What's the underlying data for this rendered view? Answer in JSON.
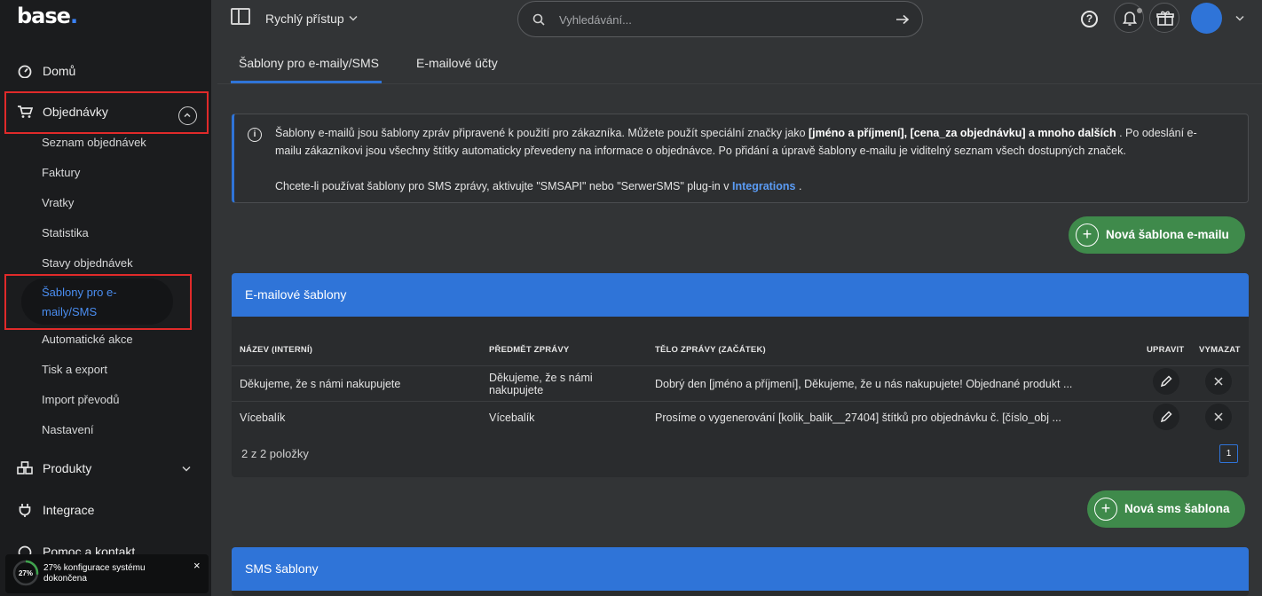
{
  "brand": {
    "logo_text": "base",
    "logo_dot": ".",
    "accent_color": "#2f74d8",
    "logo_dot_color": "#3b82f6"
  },
  "sidebar": {
    "items": [
      {
        "label": "Domů",
        "icon": "dashboard-icon"
      },
      {
        "label": "Objednávky",
        "icon": "cart-icon",
        "expanded": true
      },
      {
        "label": "Produkty",
        "icon": "boxes-icon"
      },
      {
        "label": "Integrace",
        "icon": "plug-icon"
      },
      {
        "label": "Pomoc a kontakt",
        "icon": "help-icon"
      }
    ],
    "orders_sub": [
      "Seznam objednávek",
      "Faktury",
      "Vratky",
      "Statistika",
      "Stavy objednávek",
      "Šablony pro e-maily/SMS",
      "Automatické akce",
      "Tisk a export",
      "Import převodů",
      "Nastavení"
    ],
    "progress": {
      "percent_label": "27%",
      "percent_value": 27,
      "text": "27% konfigurace systému dokončena",
      "close": "×"
    }
  },
  "topbar": {
    "quick_access": "Rychlý přístup",
    "search_placeholder": "Vyhledávání...",
    "help_symbol": "?"
  },
  "tabs": [
    {
      "label": "Šablony pro e-maily/SMS",
      "active": true
    },
    {
      "label": "E-mailové účty",
      "active": false
    }
  ],
  "info": {
    "icon_symbol": "i",
    "p1_a": "Šablony e-mailů jsou šablony zpráv připravené k použití pro zákazníka. Můžete použít speciální značky jako ",
    "p1_b1": "[jméno a příjmení]",
    "p1_c": ", ",
    "p1_b2": "[cena_za objednávku]",
    "p1_b3": " a mnoho dalších",
    "p1_d": " . Po odeslání e-mailu zákazníkovi jsou všechny štítky automaticky převedeny na informace o objednávce. Po přidání a úpravě šablony e-mailu je viditelný seznam všech dostupných značek.",
    "p2_a": "Chcete-li používat šablony pro SMS zprávy, aktivujte \"SMSAPI\" nebo \"SerwerSMS\" plug-in v ",
    "p2_link": "Integrations",
    "p2_b": " ."
  },
  "buttons": {
    "new_email": "Nová šablona e-mailu",
    "new_sms": "Nová sms šablona",
    "plus": "+"
  },
  "email_card": {
    "title": "E-mailové šablony",
    "columns": [
      "NÁZEV (INTERNÍ)",
      "PŘEDMĚT ZPRÁVY",
      "TĚLO ZPRÁVY (ZAČÁTEK)",
      "UPRAVIT",
      "VYMAZAT"
    ],
    "rows": [
      {
        "name": "Děkujeme, že s námi nakupujete",
        "subject": "Děkujeme, že s námi nakupujete",
        "body": "Dobrý den [jméno a příjmení], Děkujeme, že u nás nakupujete! Objednané produkt ..."
      },
      {
        "name": "Vícebalík",
        "subject": "Vícebalík",
        "body": "Prosíme o vygenerování [kolik_balik__27404] štítků pro objednávku č. [číslo_obj ..."
      }
    ],
    "count": "2 z 2 položky",
    "page": "1"
  },
  "sms_card": {
    "title": "SMS šablony"
  }
}
